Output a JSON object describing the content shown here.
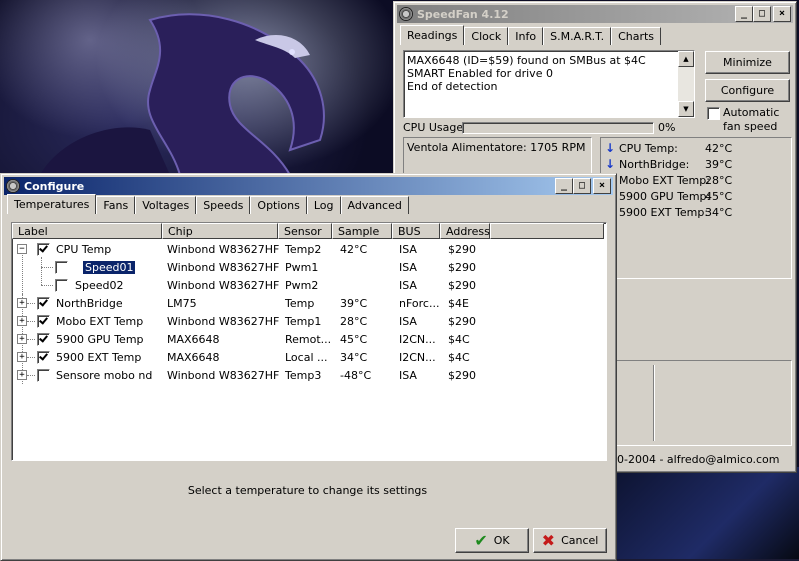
{
  "speedfan": {
    "title": "SpeedFan 4.12",
    "tabs": [
      "Readings",
      "Clock",
      "Info",
      "S.M.A.R.T.",
      "Charts"
    ],
    "log_lines": [
      "MAX6648 (ID=$59) found on SMBus at $4C",
      "SMART Enabled for drive 0",
      "End of detection"
    ],
    "minimize_label": "Minimize",
    "configure_label": "Configure",
    "auto_fan_label_1": "Automatic",
    "auto_fan_label_2": "fan speed",
    "cpu_usage_label": "CPU Usage",
    "cpu_usage_value": "0%",
    "fan_reading": "Ventola Alimentatore: 1705 RPM",
    "temps": [
      {
        "label": "CPU Temp:",
        "value": "42°C",
        "icon": "down-arrow-icon"
      },
      {
        "label": "NorthBridge:",
        "value": "39°C",
        "icon": "down-arrow-icon"
      },
      {
        "label": "Mobo EXT Temp:",
        "value": "28°C",
        "icon": ""
      },
      {
        "label": "5900 GPU Temp:",
        "value": "45°C",
        "icon": ""
      },
      {
        "label": "5900 EXT Temp:",
        "value": "34°C",
        "icon": ""
      }
    ],
    "status_text": "00-2004 - alfredo@almico.com"
  },
  "configure": {
    "title": "Configure",
    "tabs": [
      "Temperatures",
      "Fans",
      "Voltages",
      "Speeds",
      "Options",
      "Log",
      "Advanced"
    ],
    "columns": [
      "Label",
      "Chip",
      "Sensor",
      "Sample",
      "BUS",
      "Address"
    ],
    "rows": [
      {
        "expander": "−",
        "checked": true,
        "label": "CPU Temp",
        "chip": "Winbond W83627HF",
        "sensor": "Temp2",
        "sample": "42°C",
        "bus": "ISA",
        "address": "$290",
        "child": false
      },
      {
        "expander": "",
        "checked": false,
        "label": "Speed01",
        "chip": "Winbond W83627HF",
        "sensor": "Pwm1",
        "sample": "",
        "bus": "ISA",
        "address": "$290",
        "child": true,
        "selected": true
      },
      {
        "expander": "",
        "checked": false,
        "label": "Speed02",
        "chip": "Winbond W83627HF",
        "sensor": "Pwm2",
        "sample": "",
        "bus": "ISA",
        "address": "$290",
        "child": true
      },
      {
        "expander": "+",
        "checked": true,
        "label": "NorthBridge",
        "chip": "LM75",
        "sensor": "Temp",
        "sample": "39°C",
        "bus": "nForc...",
        "address": "$4E",
        "child": false
      },
      {
        "expander": "+",
        "checked": true,
        "label": "Mobo EXT Temp",
        "chip": "Winbond W83627HF",
        "sensor": "Temp1",
        "sample": "28°C",
        "bus": "ISA",
        "address": "$290",
        "child": false
      },
      {
        "expander": "+",
        "checked": true,
        "label": "5900 GPU Temp",
        "chip": "MAX6648",
        "sensor": "Remot...",
        "sample": "45°C",
        "bus": "I2CN...",
        "address": "$4C",
        "child": false
      },
      {
        "expander": "+",
        "checked": true,
        "label": "5900 EXT Temp",
        "chip": "MAX6648",
        "sensor": "Local ...",
        "sample": "34°C",
        "bus": "I2CN...",
        "address": "$4C",
        "child": false
      },
      {
        "expander": "+",
        "checked": false,
        "label": "Sensore mobo nd",
        "chip": "Winbond W83627HF",
        "sensor": "Temp3",
        "sample": "-48°C",
        "bus": "ISA",
        "address": "$290",
        "child": false
      }
    ],
    "hint": "Select a temperature to change its settings",
    "ok_label": "OK",
    "cancel_label": "Cancel"
  }
}
